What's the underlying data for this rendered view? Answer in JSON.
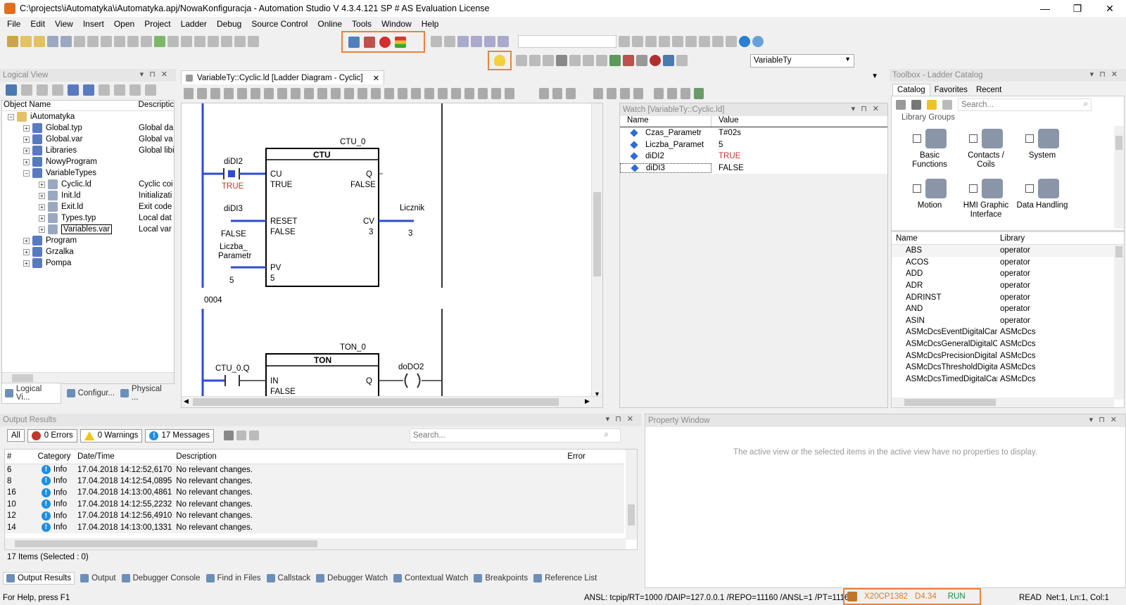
{
  "window": {
    "title": "C:\\projects\\iAutomatyka\\iAutomatyka.apj/NowaKonfiguracja - Automation Studio V 4.3.4.121 SP # AS Evaluation License"
  },
  "menu": [
    "File",
    "Edit",
    "View",
    "Insert",
    "Open",
    "Project",
    "Ladder",
    "Debug",
    "Source Control",
    "Online",
    "Tools",
    "Window",
    "Help"
  ],
  "toolbar": {
    "combo_value": "VariableTy"
  },
  "logical_view": {
    "title": "Logical View",
    "col_name": "Object Name",
    "col_desc": "Descriptic",
    "items": [
      {
        "label": "iAutomatyka",
        "desc": "",
        "level": 1
      },
      {
        "label": "Global.typ",
        "desc": "Global da",
        "level": 2
      },
      {
        "label": "Global.var",
        "desc": "Global va",
        "level": 2
      },
      {
        "label": "Libraries",
        "desc": "Global libi",
        "level": 2
      },
      {
        "label": "NowyProgram",
        "desc": "",
        "level": 2
      },
      {
        "label": "VariableTypes",
        "desc": "",
        "level": 2
      },
      {
        "label": "Cyclic.ld",
        "desc": "Cyclic coi",
        "level": 3
      },
      {
        "label": "Init.ld",
        "desc": "Initializati",
        "level": 3
      },
      {
        "label": "Exit.ld",
        "desc": "Exit code",
        "level": 3
      },
      {
        "label": "Types.typ",
        "desc": "Local dat",
        "level": 3
      },
      {
        "label": "Variables.var",
        "desc": "Local var",
        "level": 3
      },
      {
        "label": "Program",
        "desc": "",
        "level": 2
      },
      {
        "label": "Grzalka",
        "desc": "",
        "level": 2
      },
      {
        "label": "Pompa",
        "desc": "",
        "level": 2
      }
    ],
    "tabs": [
      "Logical Vi...",
      "Configur...",
      "Physical ..."
    ]
  },
  "editor": {
    "tab": "VariableTy::Cyclic.ld [Ladder Diagram - Cyclic]",
    "rung1": {
      "fb_instance": "CTU_0",
      "fb_type": "CTU",
      "in_cu": "CU",
      "in_cu_val": "TRUE",
      "in_reset": "RESET",
      "in_reset_val": "FALSE",
      "in_pv": "PV",
      "in_pv_val": "5",
      "out_q": "Q",
      "out_q_val": "FALSE",
      "out_cv": "CV",
      "out_cv_val": "3",
      "contact1": "diDI2",
      "contact1_val": "TRUE",
      "var_reset": "diDI3",
      "var_reset_val": "FALSE",
      "var_pv1": "Liczba_",
      "var_pv2": "Parametr",
      "var_pv_val": "5",
      "var_cv": "Licznik",
      "var_cv_val": "3"
    },
    "rung2": {
      "number": "0004",
      "fb_instance": "TON_0",
      "fb_type": "TON",
      "contact": "CTU_0.Q",
      "in": "IN",
      "in_val": "FALSE",
      "out_q": "Q",
      "coil": "doDO2"
    }
  },
  "watch": {
    "title": "Watch [VariableTy::Cyclic.ld]",
    "col_name": "Name",
    "col_value": "Value",
    "rows": [
      {
        "name": "Czas_Parametr",
        "value": "T#02s",
        "red": false
      },
      {
        "name": "Liczba_Paramet",
        "value": "5",
        "red": false
      },
      {
        "name": "diDI2",
        "value": "TRUE",
        "red": true
      },
      {
        "name": "diDI3",
        "value": "FALSE",
        "red": false
      }
    ]
  },
  "toolbox": {
    "title": "Toolbox - Ladder Catalog",
    "tabs": [
      "Catalog",
      "Favorites",
      "Recent"
    ],
    "search_placeholder": "Search...",
    "groups_label": "Library Groups",
    "groups": [
      "Basic Functions",
      "Contacts / Coils",
      "System",
      "Motion",
      "HMI Graphic Interface",
      "Data Handling"
    ],
    "col_name": "Name",
    "col_library": "Library",
    "rows": [
      [
        "ABS",
        "operator"
      ],
      [
        "ACOS",
        "operator"
      ],
      [
        "ADD",
        "operator"
      ],
      [
        "ADR",
        "operator"
      ],
      [
        "ADRINST",
        "operator"
      ],
      [
        "AND",
        "operator"
      ],
      [
        "ASIN",
        "operator"
      ],
      [
        "ASMcDcsEventDigitalCam...",
        "ASMcDcs"
      ],
      [
        "ASMcDcsGeneralDigitalCa...",
        "ASMcDcs"
      ],
      [
        "ASMcDcsPrecisionDigitalC...",
        "ASMcDcs"
      ],
      [
        "ASMcDcsThresholdDigital...",
        "ASMcDcs"
      ],
      [
        "ASMcDcsTimedDigitalCam...",
        "ASMcDcs"
      ]
    ]
  },
  "output": {
    "title": "Output Results",
    "all": "All",
    "errors": "0 Errors",
    "warnings": "0 Warnings",
    "messages": "17 Messages",
    "search_placeholder": "Search...",
    "cols": [
      "#",
      "Category",
      "Date/Time",
      "Description",
      "Error"
    ],
    "rows": [
      [
        "6",
        "Info",
        "17.04.2018 14:12:52,6170",
        "No relevant changes."
      ],
      [
        "8",
        "Info",
        "17.04.2018 14:12:54,0895",
        "No relevant changes."
      ],
      [
        "16",
        "Info",
        "17.04.2018 14:13:00,4861",
        "No relevant changes."
      ],
      [
        "10",
        "Info",
        "17.04.2018 14:12:55,2232",
        "No relevant changes."
      ],
      [
        "12",
        "Info",
        "17.04.2018 14:12:56,4910",
        "No relevant changes."
      ],
      [
        "14",
        "Info",
        "17.04.2018 14:13:00,1331",
        "No relevant changes."
      ]
    ],
    "footer": "17 Items (Selected : 0)",
    "tabs": [
      "Output Results",
      "Output",
      "Debugger Console",
      "Find in Files",
      "Callstack",
      "Debugger Watch",
      "Contextual Watch",
      "Breakpoints",
      "Reference List"
    ]
  },
  "property": {
    "title": "Property Window",
    "empty": "The active view or the selected items in the active view have no properties to display."
  },
  "status": {
    "help": "For Help, press F1",
    "conn": "ANSL: tcpip/RT=1000 /DAIP=127.0.0.1 /REPO=11160 /ANSL=1 /PT=11169",
    "cpu": "X20CP1382",
    "ver": "D4.34",
    "mode": "RUN",
    "right": "READ  Net:1, Ln:1, Col:1"
  }
}
